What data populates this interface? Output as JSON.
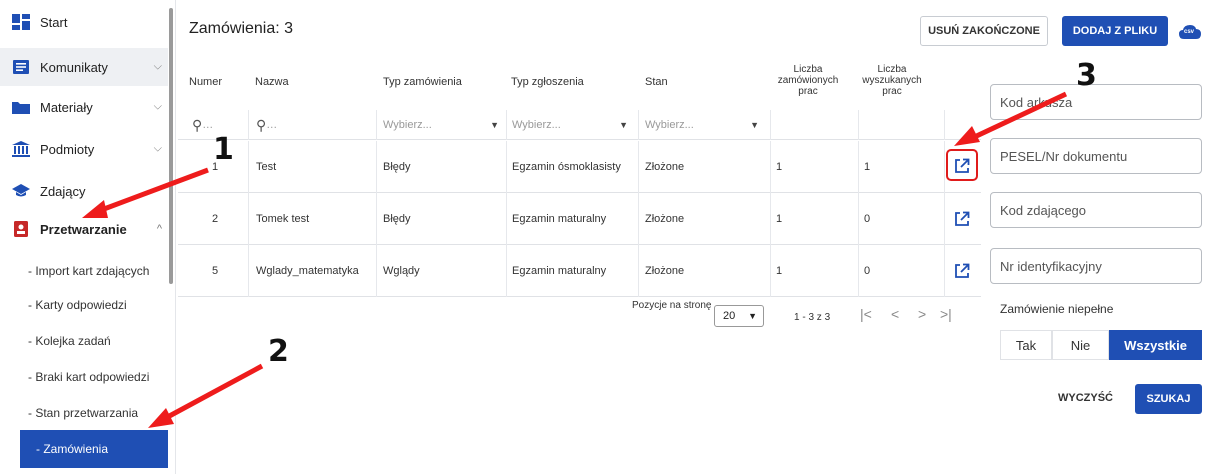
{
  "sidebar": {
    "items": [
      {
        "label": "Start",
        "icon": "dashboard-icon"
      },
      {
        "label": "Komunikaty",
        "icon": "message-icon"
      },
      {
        "label": "Materiały",
        "icon": "folder-icon"
      },
      {
        "label": "Podmioty",
        "icon": "institution-icon"
      },
      {
        "label": "Zdający",
        "icon": "graduation-cap-icon"
      },
      {
        "label": "Przetwarzanie",
        "icon": "badge-icon"
      }
    ],
    "subitems": [
      {
        "label": "- Import kart zdających"
      },
      {
        "label": "- Karty odpowiedzi"
      },
      {
        "label": "- Kolejka zadań"
      },
      {
        "label": "- Braki kart odpowiedzi"
      },
      {
        "label": "- Stan przetwarzania"
      },
      {
        "label": "- Zamówienia"
      }
    ],
    "accent_color": "#1f4fb4"
  },
  "main": {
    "title": "Zamówienia: 3",
    "btn_remove": "USUŃ ZAKOŃCZONE",
    "btn_add": "DODAJ Z PLIKU",
    "csv_label": "csv"
  },
  "table": {
    "headers": {
      "numer": "Numer",
      "nazwa": "Nazwa",
      "typ_zam": "Typ zamówienia",
      "typ_zgl": "Typ zgłoszenia",
      "stan": "Stan",
      "liczba_zam": [
        "Liczba",
        "zamówionych",
        "prac"
      ],
      "liczba_wysz": [
        "Liczba",
        "wyszukanych",
        "prac"
      ]
    },
    "filters": {
      "search_placeholder": "…",
      "select_placeholder": "Wybierz..."
    },
    "rows": [
      {
        "numer": "1",
        "nazwa": "Test",
        "typ_zam": "Błędy",
        "typ_zgl": "Egzamin ósmoklasisty",
        "stan": "Złożone",
        "zam": "1",
        "wysz": "1"
      },
      {
        "numer": "2",
        "nazwa": "Tomek test",
        "typ_zam": "Błędy",
        "typ_zgl": "Egzamin maturalny",
        "stan": "Złożone",
        "zam": "1",
        "wysz": "0"
      },
      {
        "numer": "5",
        "nazwa": "Wglady_matematyka",
        "typ_zam": "Wglądy",
        "typ_zgl": "Egzamin maturalny",
        "stan": "Złożone",
        "zam": "1",
        "wysz": "0"
      }
    ]
  },
  "pager": {
    "per_page_label": "Pozycje na stronę",
    "per_page_value": "20",
    "range": "1 - 3 z 3"
  },
  "filters_panel": {
    "kod_arkusza": "Kod arkusza",
    "pesel": "PESEL/Nr dokumentu",
    "kod_zdajacego": "Kod zdającego",
    "nr_ident": "Nr identyfikacyjny",
    "niepelne_label": "Zamówienie niepełne",
    "opt_tak": "Tak",
    "opt_nie": "Nie",
    "opt_wszystkie": "Wszystkie",
    "btn_clear": "WYCZYŚĆ",
    "btn_search": "SZUKAJ"
  },
  "annotations": {
    "n1": "1",
    "n2": "2",
    "n3": "3",
    "arrow_color": "#ee1c1c"
  }
}
